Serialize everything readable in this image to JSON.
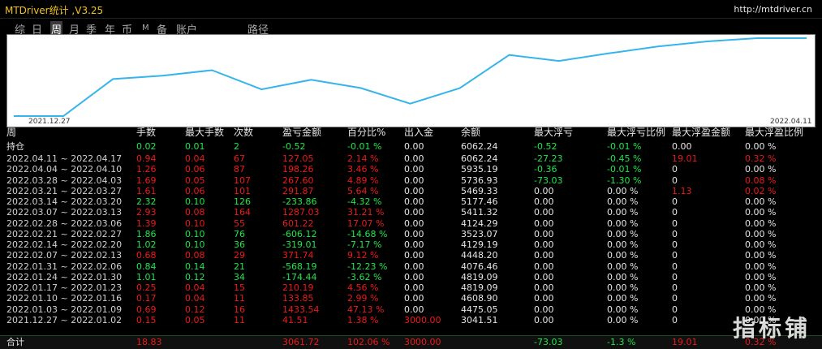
{
  "app": {
    "title": "MTDriver统计 ,V3.25",
    "url": "http://mtdriver.cn"
  },
  "tabs": [
    {
      "label": "综",
      "active": false
    },
    {
      "label": "日",
      "active": false
    },
    {
      "label": "周",
      "active": true
    },
    {
      "label": "月",
      "active": false
    },
    {
      "label": "季",
      "active": false
    },
    {
      "label": "年",
      "active": false
    },
    {
      "label": "币",
      "active": false
    },
    {
      "label": "M",
      "active": false
    },
    {
      "label": "备",
      "active": false
    },
    {
      "label": "账户",
      "active": false
    },
    {
      "label": "路径",
      "active": false
    }
  ],
  "chart_data": {
    "type": "line",
    "x": [
      "2021.12.27",
      "2022.01.03",
      "2022.01.10",
      "2022.01.17",
      "2022.01.24",
      "2022.01.31",
      "2022.02.07",
      "2022.02.14",
      "2022.02.21",
      "2022.02.28",
      "2022.03.07",
      "2022.03.14",
      "2022.03.21",
      "2022.03.28",
      "2022.04.04",
      "2022.04.11",
      "2022.04.18"
    ],
    "series": [
      {
        "values": [
          3041.51,
          3041.51,
          4475.05,
          4608.9,
          4819.09,
          4076.46,
          4448.2,
          4129.19,
          3523.07,
          4124.29,
          5411.32,
          5177.46,
          5469.33,
          5736.93,
          5935.19,
          6062.24,
          6062.24
        ]
      }
    ],
    "x_start_label": "2021.12.27",
    "x_end_label": "2022.04.11",
    "line_color": "#36b4ec"
  },
  "table": {
    "headers": [
      "周",
      "手数",
      "最大手数",
      "次数",
      "盈亏金额",
      "百分比%",
      "出入金",
      "余额",
      "最大浮亏",
      "最大浮亏比例",
      "最大浮盈金额",
      "最大浮盈比例"
    ],
    "position_row": {
      "label": "持仓",
      "cells": [
        "0.02",
        "0.01",
        "2",
        "-0.52",
        "-0.01 %",
        "0.00",
        "6062.24",
        "-0.52",
        "-0.01 %",
        "0.00",
        "0.00 %"
      ]
    },
    "rows": [
      {
        "period": "2022.04.11 ~ 2022.04.17",
        "cells": [
          "0.94",
          "0.04",
          "67",
          "127.05",
          "2.14 %",
          "0.00",
          "6062.24",
          "-27.23",
          "-0.45 %",
          "19.01",
          "0.32 %"
        ],
        "c": [
          "r",
          "r",
          "r",
          "r",
          "r",
          "w",
          "w",
          "g",
          "g",
          "r",
          "r"
        ]
      },
      {
        "period": "2022.04.04 ~ 2022.04.10",
        "cells": [
          "1.26",
          "0.06",
          "87",
          "198.26",
          "3.46 %",
          "0.00",
          "5935.19",
          "-0.36",
          "-0.01 %",
          "0",
          "0.00 %"
        ],
        "c": [
          "r",
          "r",
          "r",
          "r",
          "r",
          "w",
          "w",
          "g",
          "g",
          "w",
          "w"
        ]
      },
      {
        "period": "2022.03.28 ~ 2022.04.03",
        "cells": [
          "1.69",
          "0.05",
          "107",
          "267.60",
          "4.89 %",
          "0.00",
          "5736.93",
          "-73.03",
          "-1.30 %",
          "0",
          "0.08 %"
        ],
        "c": [
          "r",
          "r",
          "r",
          "r",
          "r",
          "w",
          "w",
          "g",
          "g",
          "w",
          "r"
        ]
      },
      {
        "period": "2022.03.21 ~ 2022.03.27",
        "cells": [
          "1.61",
          "0.06",
          "101",
          "291.87",
          "5.64 %",
          "0.00",
          "5469.33",
          "0.00",
          "0.00 %",
          "1.13",
          "0.02 %"
        ],
        "c": [
          "r",
          "r",
          "r",
          "r",
          "r",
          "w",
          "w",
          "w",
          "w",
          "r",
          "r"
        ]
      },
      {
        "period": "2022.03.14 ~ 2022.03.20",
        "cells": [
          "2.32",
          "0.10",
          "126",
          "-233.86",
          "-4.32 %",
          "0.00",
          "5177.46",
          "0.00",
          "0.00 %",
          "0",
          "0.00 %"
        ],
        "c": [
          "g",
          "g",
          "g",
          "g",
          "g",
          "w",
          "w",
          "w",
          "w",
          "w",
          "w"
        ]
      },
      {
        "period": "2022.03.07 ~ 2022.03.13",
        "cells": [
          "2.93",
          "0.08",
          "164",
          "1287.03",
          "31.21 %",
          "0.00",
          "5411.32",
          "0.00",
          "0.00 %",
          "0",
          "0.00 %"
        ],
        "c": [
          "r",
          "r",
          "r",
          "r",
          "r",
          "w",
          "w",
          "w",
          "w",
          "w",
          "w"
        ]
      },
      {
        "period": "2022.02.28 ~ 2022.03.06",
        "cells": [
          "1.39",
          "0.10",
          "55",
          "601.22",
          "17.07 %",
          "0.00",
          "4124.29",
          "0.00",
          "0.00 %",
          "0",
          "0.00 %"
        ],
        "c": [
          "r",
          "r",
          "r",
          "r",
          "r",
          "w",
          "w",
          "w",
          "w",
          "w",
          "w"
        ]
      },
      {
        "period": "2022.02.21 ~ 2022.02.27",
        "cells": [
          "1.86",
          "0.10",
          "76",
          "-606.12",
          "-14.68 %",
          "0.00",
          "3523.07",
          "0.00",
          "0.00 %",
          "0",
          "0.00 %"
        ],
        "c": [
          "g",
          "g",
          "g",
          "g",
          "g",
          "w",
          "w",
          "w",
          "w",
          "w",
          "w"
        ]
      },
      {
        "period": "2022.02.14 ~ 2022.02.20",
        "cells": [
          "1.02",
          "0.10",
          "36",
          "-319.01",
          "-7.17 %",
          "0.00",
          "4129.19",
          "0.00",
          "0.00 %",
          "0",
          "0.00 %"
        ],
        "c": [
          "g",
          "g",
          "g",
          "g",
          "g",
          "w",
          "w",
          "w",
          "w",
          "w",
          "w"
        ]
      },
      {
        "period": "2022.02.07 ~ 2022.02.13",
        "cells": [
          "0.68",
          "0.08",
          "29",
          "371.74",
          "9.12 %",
          "0.00",
          "4448.20",
          "0.00",
          "0.00 %",
          "0",
          "0.00 %"
        ],
        "c": [
          "r",
          "r",
          "r",
          "r",
          "r",
          "w",
          "w",
          "w",
          "w",
          "w",
          "w"
        ]
      },
      {
        "period": "2022.01.31 ~ 2022.02.06",
        "cells": [
          "0.84",
          "0.14",
          "21",
          "-568.19",
          "-12.23 %",
          "0.00",
          "4076.46",
          "0.00",
          "0.00 %",
          "0",
          "0.00 %"
        ],
        "c": [
          "g",
          "g",
          "g",
          "g",
          "g",
          "w",
          "w",
          "w",
          "w",
          "w",
          "w"
        ]
      },
      {
        "period": "2022.01.24 ~ 2022.01.30",
        "cells": [
          "1.01",
          "0.12",
          "34",
          "-174.44",
          "-3.62 %",
          "0.00",
          "4819.09",
          "0.00",
          "0.00 %",
          "0",
          "0.00 %"
        ],
        "c": [
          "g",
          "g",
          "g",
          "g",
          "g",
          "w",
          "w",
          "w",
          "w",
          "w",
          "w"
        ]
      },
      {
        "period": "2022.01.17 ~ 2022.01.23",
        "cells": [
          "0.25",
          "0.04",
          "15",
          "210.19",
          "4.56 %",
          "0.00",
          "4819.09",
          "0.00",
          "0.00 %",
          "0",
          "0.00 %"
        ],
        "c": [
          "r",
          "r",
          "r",
          "r",
          "r",
          "w",
          "w",
          "w",
          "w",
          "w",
          "w"
        ]
      },
      {
        "period": "2022.01.10 ~ 2022.01.16",
        "cells": [
          "0.17",
          "0.04",
          "11",
          "133.85",
          "2.99 %",
          "0.00",
          "4608.90",
          "0.00",
          "0.00 %",
          "0",
          "0.00 %"
        ],
        "c": [
          "r",
          "r",
          "r",
          "r",
          "r",
          "w",
          "w",
          "w",
          "w",
          "w",
          "w"
        ]
      },
      {
        "period": "2022.01.03 ~ 2022.01.09",
        "cells": [
          "0.69",
          "0.12",
          "16",
          "1433.54",
          "47.13 %",
          "0.00",
          "4475.05",
          "0.00",
          "0.00 %",
          "0",
          "0.00 %"
        ],
        "c": [
          "r",
          "r",
          "r",
          "r",
          "r",
          "w",
          "w",
          "w",
          "w",
          "w",
          "w"
        ]
      },
      {
        "period": "2021.12.27 ~ 2022.01.02",
        "cells": [
          "0.15",
          "0.05",
          "11",
          "41.51",
          "1.38 %",
          "3000.00",
          "3041.51",
          "0.00",
          "0.00 %",
          "0",
          "0.00 %"
        ],
        "c": [
          "r",
          "r",
          "r",
          "r",
          "r",
          "r",
          "w",
          "w",
          "w",
          "w",
          "w"
        ]
      }
    ],
    "total": {
      "label": "合计",
      "cells": [
        "18.83",
        "",
        "",
        "3061.72",
        "102.06 %",
        "3000.00",
        "",
        "-73.03",
        "-1.3 %",
        "19.01",
        "0.32 %"
      ],
      "c": [
        "r",
        "w",
        "w",
        "r",
        "r",
        "r",
        "w",
        "g",
        "g",
        "r",
        "r"
      ]
    }
  },
  "watermark": "指标铺",
  "colors": {
    "profit": "#f01818",
    "loss": "#1fe64a",
    "title": "#f2c21b",
    "line": "#36b4ec"
  }
}
